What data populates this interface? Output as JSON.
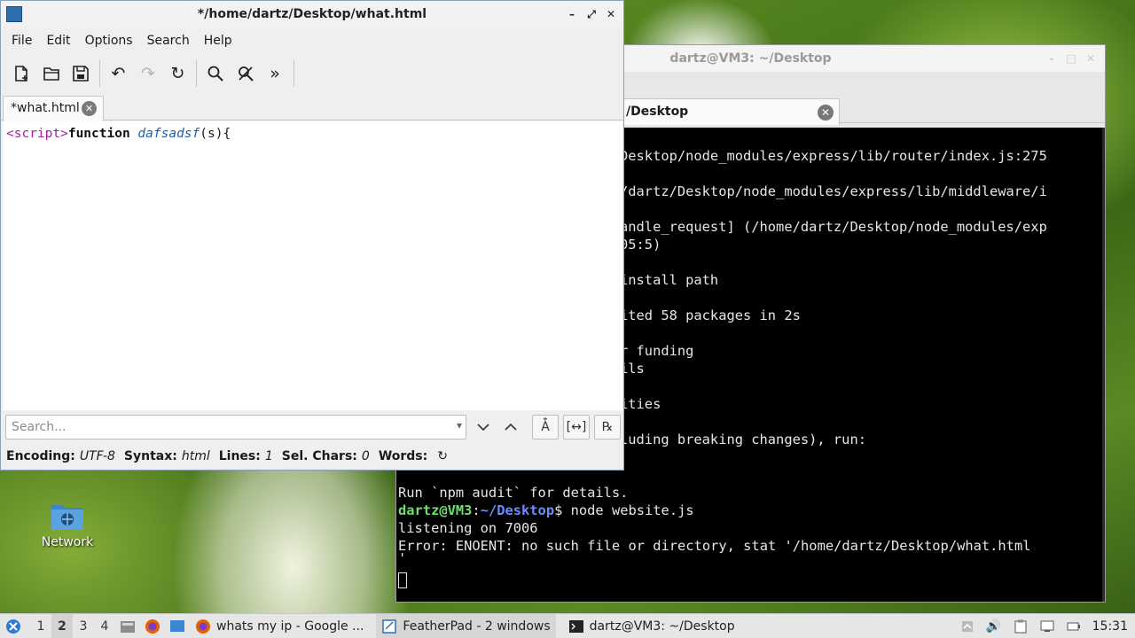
{
  "desktop": {
    "icons": [
      {
        "label": "Network",
        "icon": "network-folder-icon"
      }
    ]
  },
  "terminal": {
    "title": "dartz@VM3: ~/Desktop",
    "tab_label": "/Desktop",
    "lines": [
      "Desktop/node_modules/express/lib/router/index.js:275",
      "",
      "/dartz/Desktop/node_modules/express/lib/middleware/i",
      "",
      "andle_request] (/home/dartz/Desktop/node_modules/exp",
      "05:5)",
      "",
      "install path",
      "",
      "ited 58 packages in 2s",
      "",
      "r funding",
      "ils",
      "",
      "ities",
      "",
      "luding breaking changes), run:",
      "",
      "",
      "Run `npm audit` for details."
    ],
    "prompt_user": "dartz@VM3",
    "prompt_sep": ":",
    "prompt_path": "~/Desktop",
    "prompt_cmd": "$ node website.js",
    "line_listen": "listening on 7006",
    "line_error": "Error: ENOENT: no such file or directory, stat '/home/dartz/Desktop/what.html",
    "line_quote": "'"
  },
  "featherpad": {
    "title": "*/home/dartz/Desktop/what.html",
    "menu": [
      "File",
      "Edit",
      "Options",
      "Search",
      "Help"
    ],
    "toolbar_icons": [
      "new-document-icon",
      "open-folder-icon",
      "save-icon",
      "undo-icon",
      "redo-icon",
      "reload-icon",
      "find-icon",
      "find-replace-icon",
      "more-chevron-icon"
    ],
    "tab_label": "*what.html",
    "code": {
      "tag": "<script>",
      "keyword": "function",
      "space": " ",
      "fn_name": "dafsadsf",
      "rest": "(s){"
    },
    "search": {
      "placeholder": "Search...",
      "value": ""
    },
    "status": {
      "encoding_label": "Encoding:",
      "encoding": "UTF-8",
      "syntax_label": "Syntax:",
      "syntax": "html",
      "lines_label": "Lines:",
      "lines": "1",
      "selchars_label": "Sel. Chars:",
      "selchars": "0",
      "words_label": "Words:"
    }
  },
  "taskbar": {
    "workspaces": [
      "1",
      "2",
      "3",
      "4"
    ],
    "active_workspace": "2",
    "tasks": [
      {
        "label": "whats my ip - Google ...",
        "icon": "firefox-icon"
      },
      {
        "label": "FeatherPad - 2 windows",
        "icon": "featherpad-icon"
      },
      {
        "label": "dartz@VM3: ~/Desktop",
        "icon": "terminal-icon"
      }
    ],
    "clock": "15:31"
  }
}
